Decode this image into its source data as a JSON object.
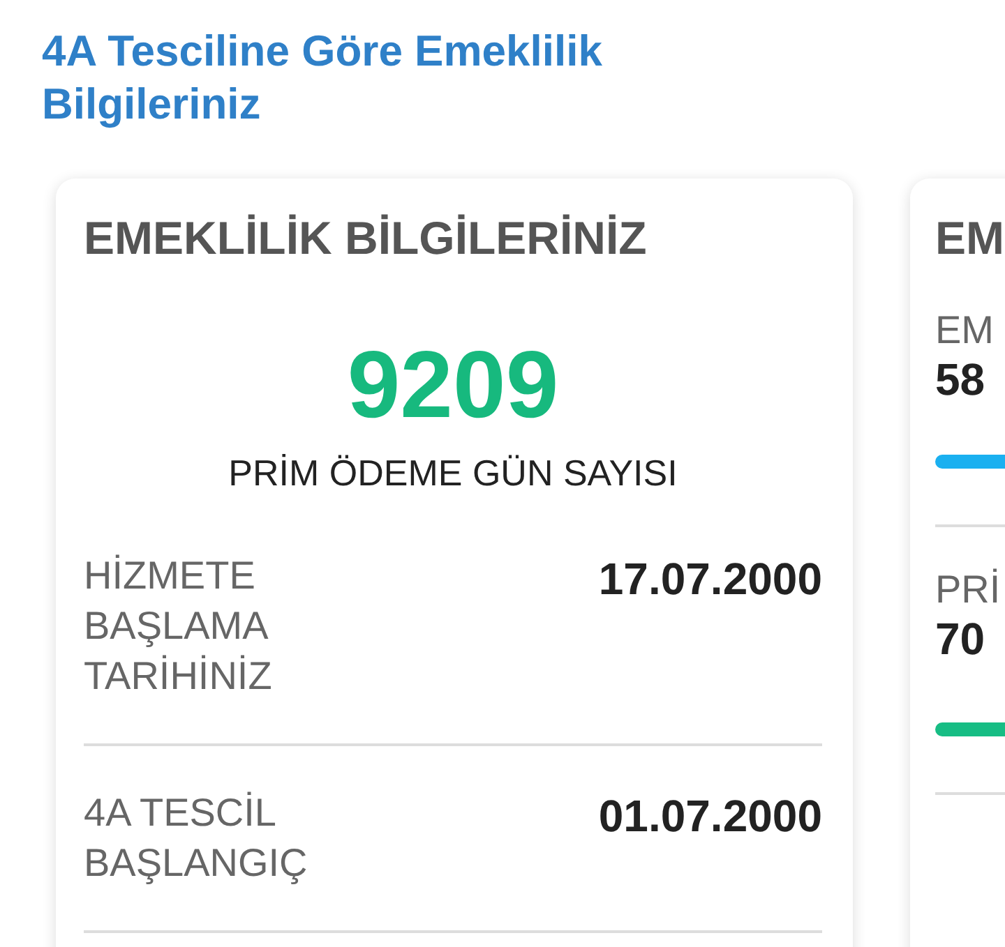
{
  "page_title": "4A Tesciline Göre Emeklilik Bilgileriniz",
  "summary_card": {
    "heading": "EMEKLİLİK BİLGİLERİNİZ",
    "total": "9209",
    "total_label": "PRİM ÖDEME GÜN SAYISI",
    "rows": [
      {
        "label": "HİZMETE BAŞLAMA TARİHİNİZ",
        "value": "17.07.2000"
      },
      {
        "label": "4A TESCİL BAŞLANGIÇ",
        "value": "01.07.2000"
      }
    ]
  },
  "second_card": {
    "heading": "EM",
    "items": [
      {
        "label": "EM",
        "value": "58",
        "color": "#1ab0f0"
      },
      {
        "label": "PRİ",
        "value": "70",
        "color": "#17bd84"
      }
    ]
  }
}
